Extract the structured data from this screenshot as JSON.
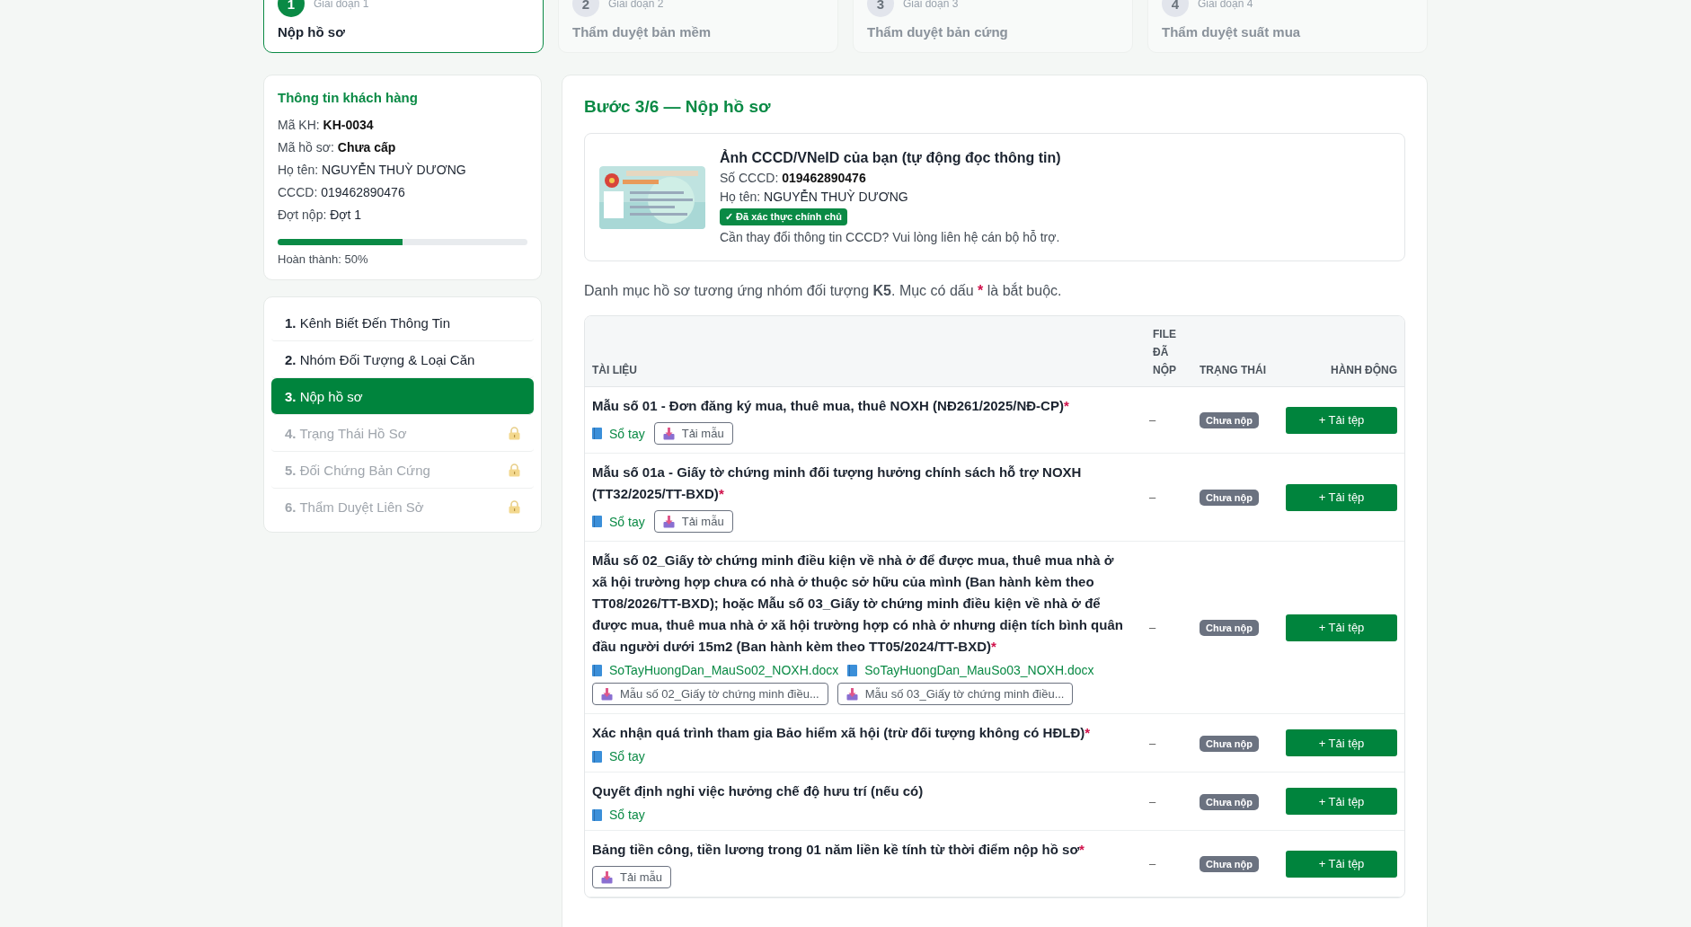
{
  "stages": [
    {
      "number": "1",
      "phase": "Giai đoạn 1",
      "title": "Nộp hồ sơ",
      "selected": true
    },
    {
      "number": "2",
      "phase": "Giai đoạn 2",
      "title": "Thẩm duyệt bản mềm",
      "selected": false
    },
    {
      "number": "3",
      "phase": "Giai đoạn 3",
      "title": "Thẩm duyệt bản cứng",
      "selected": false
    },
    {
      "number": "4",
      "phase": "Giai đoạn 4",
      "title": "Thẩm duyệt suất mua",
      "selected": false
    }
  ],
  "customer": {
    "title": "Thông tin khách hàng",
    "fields": [
      {
        "label": "Mã KH:",
        "value": "KH-0034",
        "bold": true
      },
      {
        "label": "Mã hồ sơ:",
        "value": "Chưa cấp",
        "bold": true
      },
      {
        "label": "Họ tên:",
        "value": "NGUYỄN THUỲ DƯƠNG",
        "bold": false
      },
      {
        "label": "CCCD:",
        "value": "019462890476",
        "bold": false
      },
      {
        "label": "Đợt nộp:",
        "value": "Đợt 1",
        "bold": false
      }
    ],
    "progress": {
      "level": 0.5,
      "label": "Hoàn thành: 50%"
    }
  },
  "nav": [
    {
      "number": "1.",
      "label": "Kênh Biết Đến Thông Tin",
      "selected": false,
      "locked": false
    },
    {
      "number": "2.",
      "label": "Nhóm Đối Tượng & Loại Căn",
      "selected": false,
      "locked": false
    },
    {
      "number": "3.",
      "label": "Nộp hồ sơ",
      "selected": true,
      "locked": false
    },
    {
      "number": "4.",
      "label": "Trạng Thái Hồ Sơ",
      "selected": false,
      "locked": true
    },
    {
      "number": "5.",
      "label": "Đối Chứng Bản Cứng",
      "selected": false,
      "locked": true
    },
    {
      "number": "6.",
      "label": "Thẩm Duyệt Liên Sở",
      "selected": false,
      "locked": true
    }
  ],
  "main": {
    "title": "Bước 3/6 — Nộp hồ sơ",
    "id_card": {
      "title": "Ảnh CCCD/VNeID của bạn (tự động đọc thông tin)",
      "fields": [
        {
          "label": "Số CCCD:",
          "value": "019462890476",
          "bold": true
        },
        {
          "label": "Họ tên:",
          "value": "NGUYỄN THUỲ DƯƠNG",
          "bold": false
        }
      ],
      "badge": "✓ Đã xác thực chính chủ",
      "note": "Cần thay đổi thông tin CCCD? Vui lòng liên hệ cán bộ hỗ trợ."
    },
    "intro": {
      "before": "Danh mục hồ sơ tương ứng nhóm đối tượng **K5**. Mục có dấu",
      "mark": "*",
      "after": "là bắt buộc."
    },
    "table": {
      "columns": [
        "TÀI LIỆU",
        "FILE ĐÃ NỘP",
        "TRẠNG THÁI",
        "HÀNH ĐỘNG"
      ],
      "rows": [
        {
          "title": "Mẫu số 01 - Đơn đăng ký mua, thuê mua, thuê NOXH (NĐ261/2025/NĐ-CP)",
          "required": true,
          "attachments": [
            {
              "kind": "link",
              "label": "Sổ tay"
            },
            {
              "kind": "template",
              "label": "Tải mẫu"
            }
          ],
          "file": "–",
          "status": "Chưa nộp",
          "action": "+ Tải tệp"
        },
        {
          "title": "Mẫu số 01a - Giấy tờ chứng minh đối tượng hưởng chính sách hỗ trợ NOXH (TT32/2025/TT-BXD)",
          "required": true,
          "attachments": [
            {
              "kind": "link",
              "label": "Sổ tay"
            },
            {
              "kind": "template",
              "label": "Tải mẫu"
            }
          ],
          "file": "–",
          "status": "Chưa nộp",
          "action": "+ Tải tệp"
        },
        {
          "title": "Mẫu số 02_Giấy tờ chứng minh điều kiện về nhà ở để được mua, thuê mua nhà ở xã hội trường hợp chưa có nhà ở thuộc sở hữu của mình (Ban hành kèm theo TT08/2026/TT-BXD); hoặc Mẫu số 03_Giấy tờ chứng minh điều kiện về nhà ở để được mua, thuê mua nhà ở xã hội trường hợp có nhà ở nhưng diện tích bình quân đầu người dưới 15m2 (Ban hành kèm theo TT05/2024/TT-BXD)",
          "required": true,
          "attachments": [
            {
              "kind": "link",
              "label": "SoTayHuongDan_MauSo02_NOXH.docx"
            },
            {
              "kind": "link",
              "label": "SoTayHuongDan_MauSo03_NOXH.docx"
            },
            {
              "kind": "template",
              "label": "Mẫu số 02_Giấy tờ chứng minh điều..."
            },
            {
              "kind": "template",
              "label": "Mẫu số 03_Giấy tờ chứng minh điều..."
            }
          ],
          "file": "–",
          "status": "Chưa nộp",
          "action": "+ Tải tệp"
        },
        {
          "title": "Xác nhận quá trình tham gia Bảo hiểm xã hội (trừ đối tượng không có HĐLĐ)",
          "required": true,
          "attachments": [
            {
              "kind": "link",
              "label": "Sổ tay"
            }
          ],
          "file": "–",
          "status": "Chưa nộp",
          "action": "+ Tải tệp"
        },
        {
          "title": "Quyết định nghỉ việc hưởng chế độ hưu trí (nếu có)",
          "required": false,
          "attachments": [
            {
              "kind": "link",
              "label": "Sổ tay"
            }
          ],
          "file": "–",
          "status": "Chưa nộp",
          "action": "+ Tải tệp"
        },
        {
          "title": "Bảng tiền công, tiền lương trong 01 năm liền kề tính từ thời điểm nộp hồ sơ",
          "required": true,
          "attachments": [
            {
              "kind": "template",
              "label": "Tải mẫu"
            }
          ],
          "file": "–",
          "status": "Chưa nộp",
          "action": "+ Tải tệp"
        }
      ]
    }
  }
}
